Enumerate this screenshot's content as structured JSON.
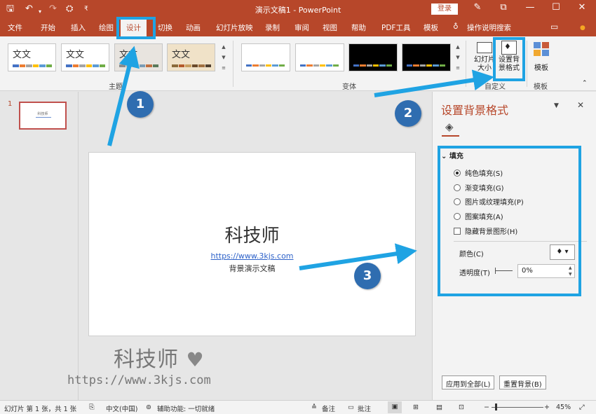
{
  "titlebar": {
    "title": "演示文稿1  -  PowerPoint",
    "login": "登录",
    "icons": [
      "save-icon",
      "undo-icon",
      "redo-icon",
      "presenter-icon",
      "customize-icon",
      "pen-icon",
      "ribbon-display-icon",
      "minimize-icon",
      "maximize-icon",
      "close-icon"
    ]
  },
  "tabs": [
    "文件",
    "开始",
    "插入",
    "绘图",
    "设计",
    "切换",
    "动画",
    "幻灯片放映",
    "录制",
    "审阅",
    "视图",
    "帮助",
    "PDF工具",
    "模板"
  ],
  "active_tab": "设计",
  "search": "操作说明搜索",
  "ribbon": {
    "theme_text": "文文",
    "themes_group": "主题",
    "variants_group": "变体",
    "slide_size": "幻灯片大小",
    "format_background": "设置背景格式",
    "customize_group": "自定义",
    "template": "模板",
    "template_group": "模板"
  },
  "thumbs": {
    "number": "1"
  },
  "slide": {
    "title": "科技师",
    "url": "https://www.3kjs.com",
    "subtitle": "背景演示文稿"
  },
  "watermark": {
    "name": "科技师",
    "url": "https://www.3kjs.com"
  },
  "format_pane": {
    "title": "设置背景格式",
    "section": "填充",
    "options": {
      "solid": "纯色填充(S)",
      "gradient": "渐变填充(G)",
      "picture": "图片或纹理填充(P)",
      "pattern": "图案填充(A)",
      "hide": "隐藏背景图形(H)"
    },
    "selected": "solid",
    "color_label": "颜色(C)",
    "transparency_label": "透明度(T)",
    "transparency_value": "0%",
    "apply_all": "应用到全部(L)",
    "reset": "重置背景(B)"
  },
  "statusbar": {
    "slide_info": "幻灯片 第 1 张，共 1 张",
    "language": "中文(中国)",
    "accessibility": "辅助功能: 一切就绪",
    "notes": "备注",
    "comments": "批注",
    "zoom": "45%"
  },
  "annotations": {
    "badge1": "1",
    "badge2": "2",
    "badge3": "3"
  },
  "colors": {
    "accent": "#b7472a",
    "callout": "#1fa3e3",
    "badge": "#2f6db0"
  }
}
